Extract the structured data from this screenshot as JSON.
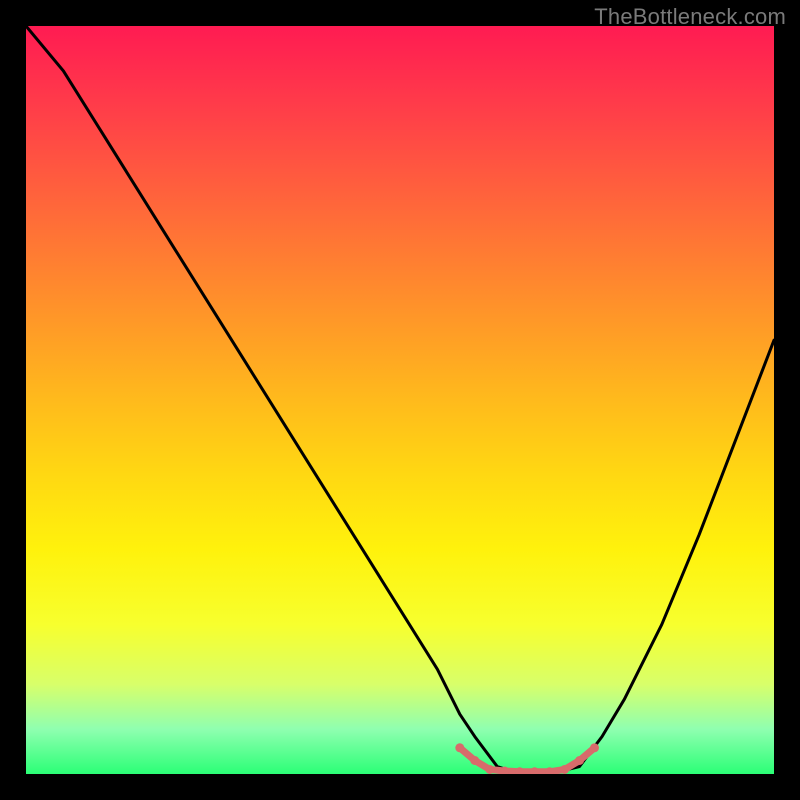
{
  "watermark": "TheBottleneck.com",
  "gradient_colors": {
    "top": "#ff1b52",
    "mid": "#ffd812",
    "bottom": "#2bff76"
  },
  "chart_data": {
    "type": "line",
    "title": "",
    "xlabel": "",
    "ylabel": "",
    "xlim": [
      0,
      100
    ],
    "ylim": [
      0,
      100
    ],
    "description": "V-shaped bottleneck curve on vertical spectrum gradient (red = high bottleneck, green = low). Minimum reached around x ≈ 63-74.",
    "series": [
      {
        "name": "bottleneck-curve",
        "x": [
          0,
          5,
          10,
          15,
          20,
          25,
          30,
          35,
          40,
          45,
          50,
          55,
          58,
          60,
          63,
          66,
          70,
          74,
          77,
          80,
          85,
          90,
          95,
          100
        ],
        "values": [
          100,
          94,
          86,
          78,
          70,
          62,
          54,
          46,
          38,
          30,
          22,
          14,
          8,
          5,
          1,
          0,
          0,
          1,
          5,
          10,
          20,
          32,
          45,
          58
        ]
      },
      {
        "name": "marker-band",
        "x": [
          58,
          60,
          62,
          64,
          66,
          68,
          70,
          72,
          74,
          76
        ],
        "values": [
          3.5,
          1.8,
          0.6,
          0.4,
          0.3,
          0.3,
          0.3,
          0.6,
          1.8,
          3.5
        ]
      }
    ],
    "marker_color": "#d86b6b"
  }
}
